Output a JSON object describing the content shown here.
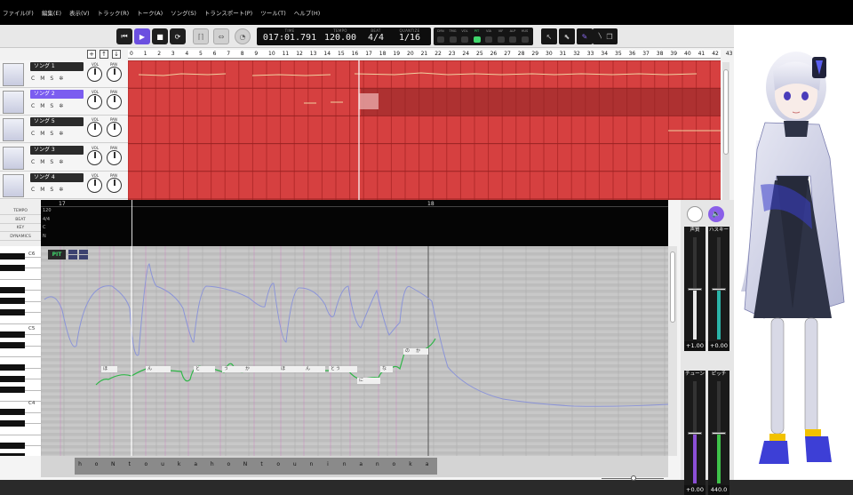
{
  "menu": [
    "ファイル(F)",
    "編集(E)",
    "表示(V)",
    "トラック(R)",
    "トーク(A)",
    "ソング(S)",
    "トランスポート(P)",
    "ツール(T)",
    "ヘルプ(H)"
  ],
  "display": {
    "time_label": "TIME",
    "time": "017:01.791",
    "tempo_label": "TEMPO",
    "tempo": "120.00",
    "beat_label": "BEAT",
    "beat": "4/4",
    "quantize_label": "QUANTIZE",
    "quantize": "1/16"
  },
  "modes": [
    "DYN",
    "TMG",
    "VOL",
    "PIT",
    "VIA",
    "VIF",
    "ALP",
    "HUS"
  ],
  "active_mode": "PIT",
  "tracks": [
    {
      "name": "ソング 1",
      "vol_label": "VOL",
      "pan_label": "PAN"
    },
    {
      "name": "ソング 2",
      "vol_label": "VOL",
      "pan_label": "PAN"
    },
    {
      "name": "ソング 5",
      "vol_label": "VOL",
      "pan_label": "PAN"
    },
    {
      "name": "ソング 3",
      "vol_label": "VOL",
      "pan_label": "PAN"
    },
    {
      "name": "ソング 4",
      "vol_label": "VOL",
      "pan_label": "PAN"
    }
  ],
  "track_buttons": [
    "C",
    "M",
    "S",
    "✲"
  ],
  "measure_numbers": [
    "0",
    "1",
    "2",
    "3",
    "4",
    "5",
    "6",
    "7",
    "8",
    "9",
    "10",
    "11",
    "12",
    "13",
    "14",
    "15",
    "16",
    "17",
    "18",
    "19",
    "20",
    "21",
    "22",
    "23",
    "24",
    "25",
    "26",
    "27",
    "28",
    "29",
    "30",
    "31",
    "32",
    "33",
    "34",
    "35",
    "36",
    "37",
    "38",
    "39",
    "40",
    "41",
    "42",
    "43"
  ],
  "piano": {
    "info_rows": [
      "TEMPO",
      "BEAT",
      "KEY",
      "DYNAMICS"
    ],
    "header_values": [
      "120",
      "4/4",
      "C",
      "N"
    ],
    "header_measures": [
      "17",
      "18"
    ],
    "note_labels": [
      "C6",
      "C5",
      "C4"
    ],
    "pit_label": "PIT",
    "lyrics": [
      "ほ",
      "ん",
      "と",
      "う",
      "か",
      "ほ",
      "ん",
      "と",
      "う",
      "に",
      "な",
      "の",
      "か"
    ],
    "phonemes": [
      "h",
      "o",
      "N",
      "t",
      "o",
      "u",
      "k",
      "a",
      "h",
      "o",
      "N",
      "t",
      "o",
      "u",
      "n",
      "i",
      "n",
      "a",
      "n",
      "o",
      "k",
      "a"
    ]
  },
  "sliders": [
    {
      "label": "声質",
      "value": "+1.00",
      "color": "#e8e8e8"
    },
    {
      "label": "ハスキー",
      "value": "+0.00",
      "color": "#2bb3a8"
    },
    {
      "label": "チューン",
      "value": "+0.00",
      "color": "#8b4fd6"
    },
    {
      "label": "ピッチ",
      "value": "440.0",
      "color": "#3fc24a"
    }
  ]
}
